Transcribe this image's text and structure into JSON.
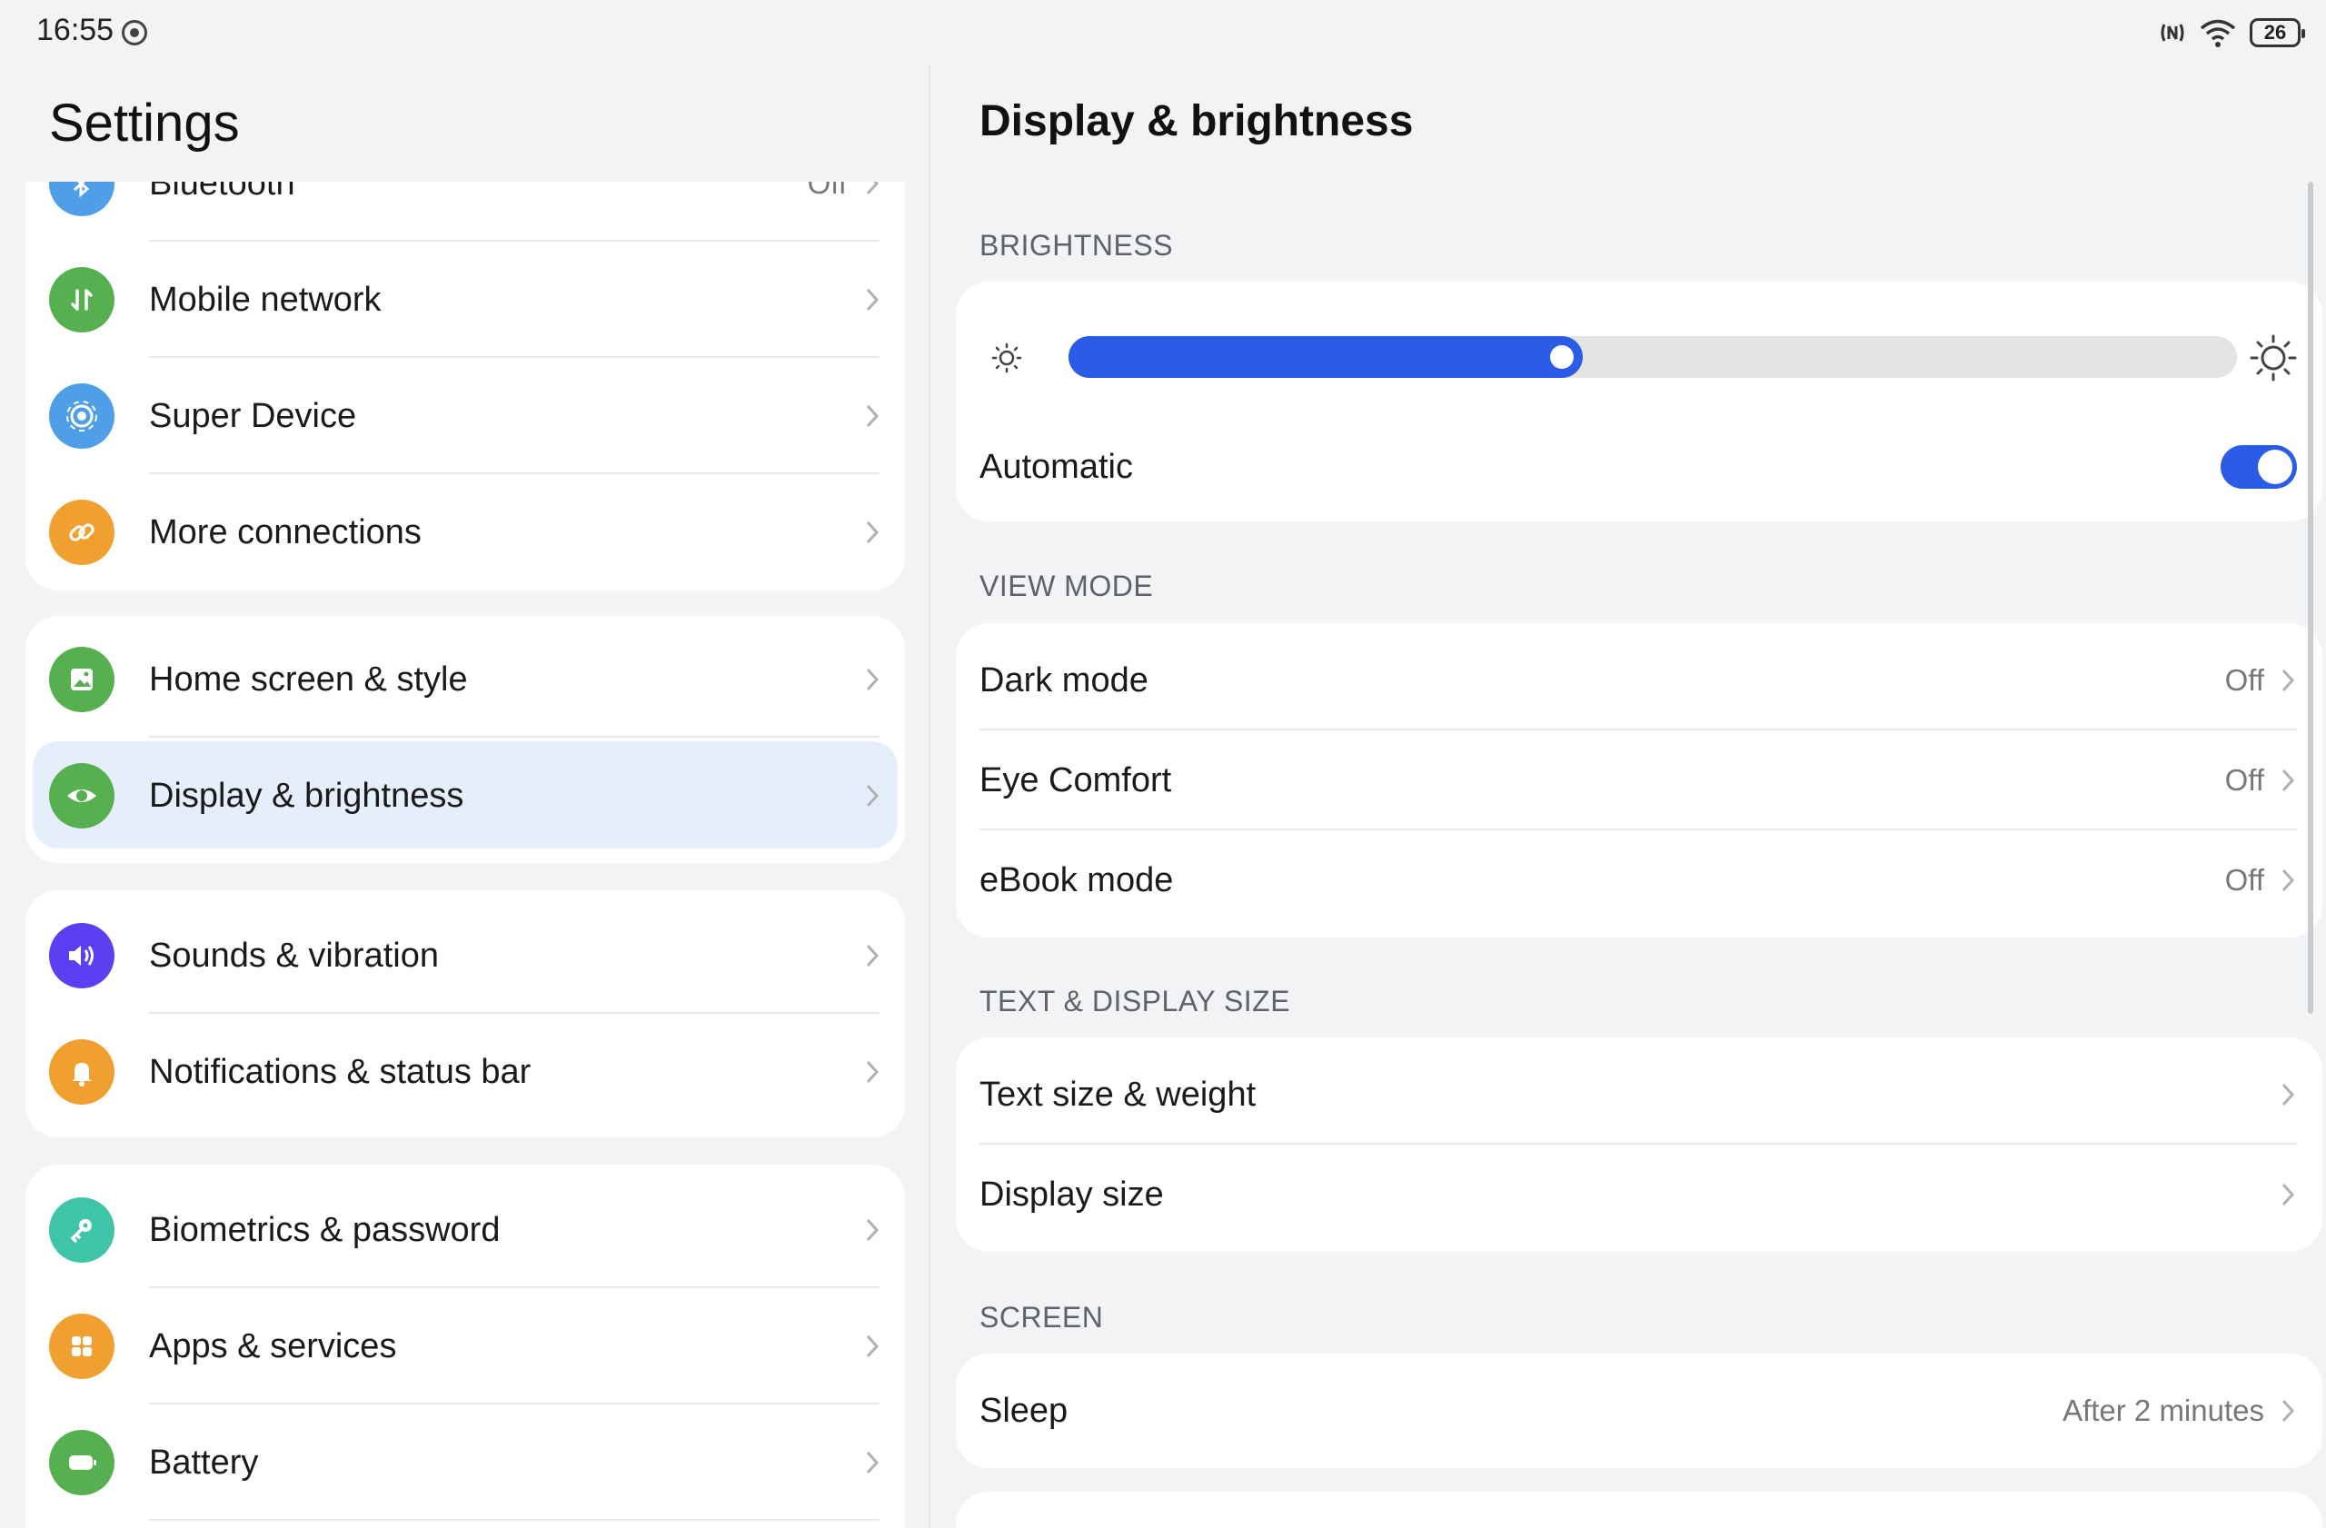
{
  "status_bar": {
    "time": "16:55",
    "battery": "26",
    "icons": [
      "notification-dot-icon",
      "nfc-icon",
      "wifi-icon",
      "battery-icon"
    ]
  },
  "left": {
    "title": "Settings",
    "groups": [
      {
        "items": [
          {
            "label": "Bluetooth",
            "value": "Off",
            "icon": "bluetooth-icon",
            "color": "#4f9fe8"
          },
          {
            "label": "Mobile network",
            "icon": "mobile-network-icon",
            "color": "#57b04f"
          },
          {
            "label": "Super Device",
            "icon": "super-device-icon",
            "color": "#4f9fe8"
          },
          {
            "label": "More connections",
            "icon": "link-icon",
            "color": "#f0a030"
          }
        ]
      },
      {
        "items": [
          {
            "label": "Home screen & style",
            "icon": "image-icon",
            "color": "#57b04f"
          },
          {
            "label": "Display & brightness",
            "icon": "eye-icon",
            "color": "#57b04f",
            "selected": true
          }
        ]
      },
      {
        "items": [
          {
            "label": "Sounds & vibration",
            "icon": "speaker-icon",
            "color": "#5b3ff0"
          },
          {
            "label": "Notifications & status bar",
            "icon": "bell-icon",
            "color": "#f0a030"
          }
        ]
      },
      {
        "items": [
          {
            "label": "Biometrics & password",
            "icon": "key-icon",
            "color": "#3fc4a8"
          },
          {
            "label": "Apps & services",
            "icon": "apps-grid-icon",
            "color": "#f0a030"
          },
          {
            "label": "Battery",
            "icon": "battery-icon",
            "color": "#57b04f"
          }
        ]
      }
    ]
  },
  "right": {
    "title": "Display & brightness",
    "brightness": {
      "label": "BRIGHTNESS",
      "level": 0.44,
      "automatic_label": "Automatic",
      "automatic_on": true
    },
    "view_mode": {
      "label": "VIEW MODE",
      "items": [
        {
          "label": "Dark mode",
          "value": "Off"
        },
        {
          "label": "Eye Comfort",
          "value": "Off"
        },
        {
          "label": "eBook mode",
          "value": "Off"
        }
      ]
    },
    "text_display_size": {
      "label": "TEXT & DISPLAY SIZE",
      "items": [
        {
          "label": "Text size & weight"
        },
        {
          "label": "Display size"
        }
      ]
    },
    "screen": {
      "label": "SCREEN",
      "items": [
        {
          "label": "Sleep",
          "value": "After 2 minutes"
        }
      ]
    }
  },
  "colors": {
    "accent": "#2b5ce6",
    "selected_bg": "#e5eefb",
    "page_bg": "#f1f3f5"
  }
}
